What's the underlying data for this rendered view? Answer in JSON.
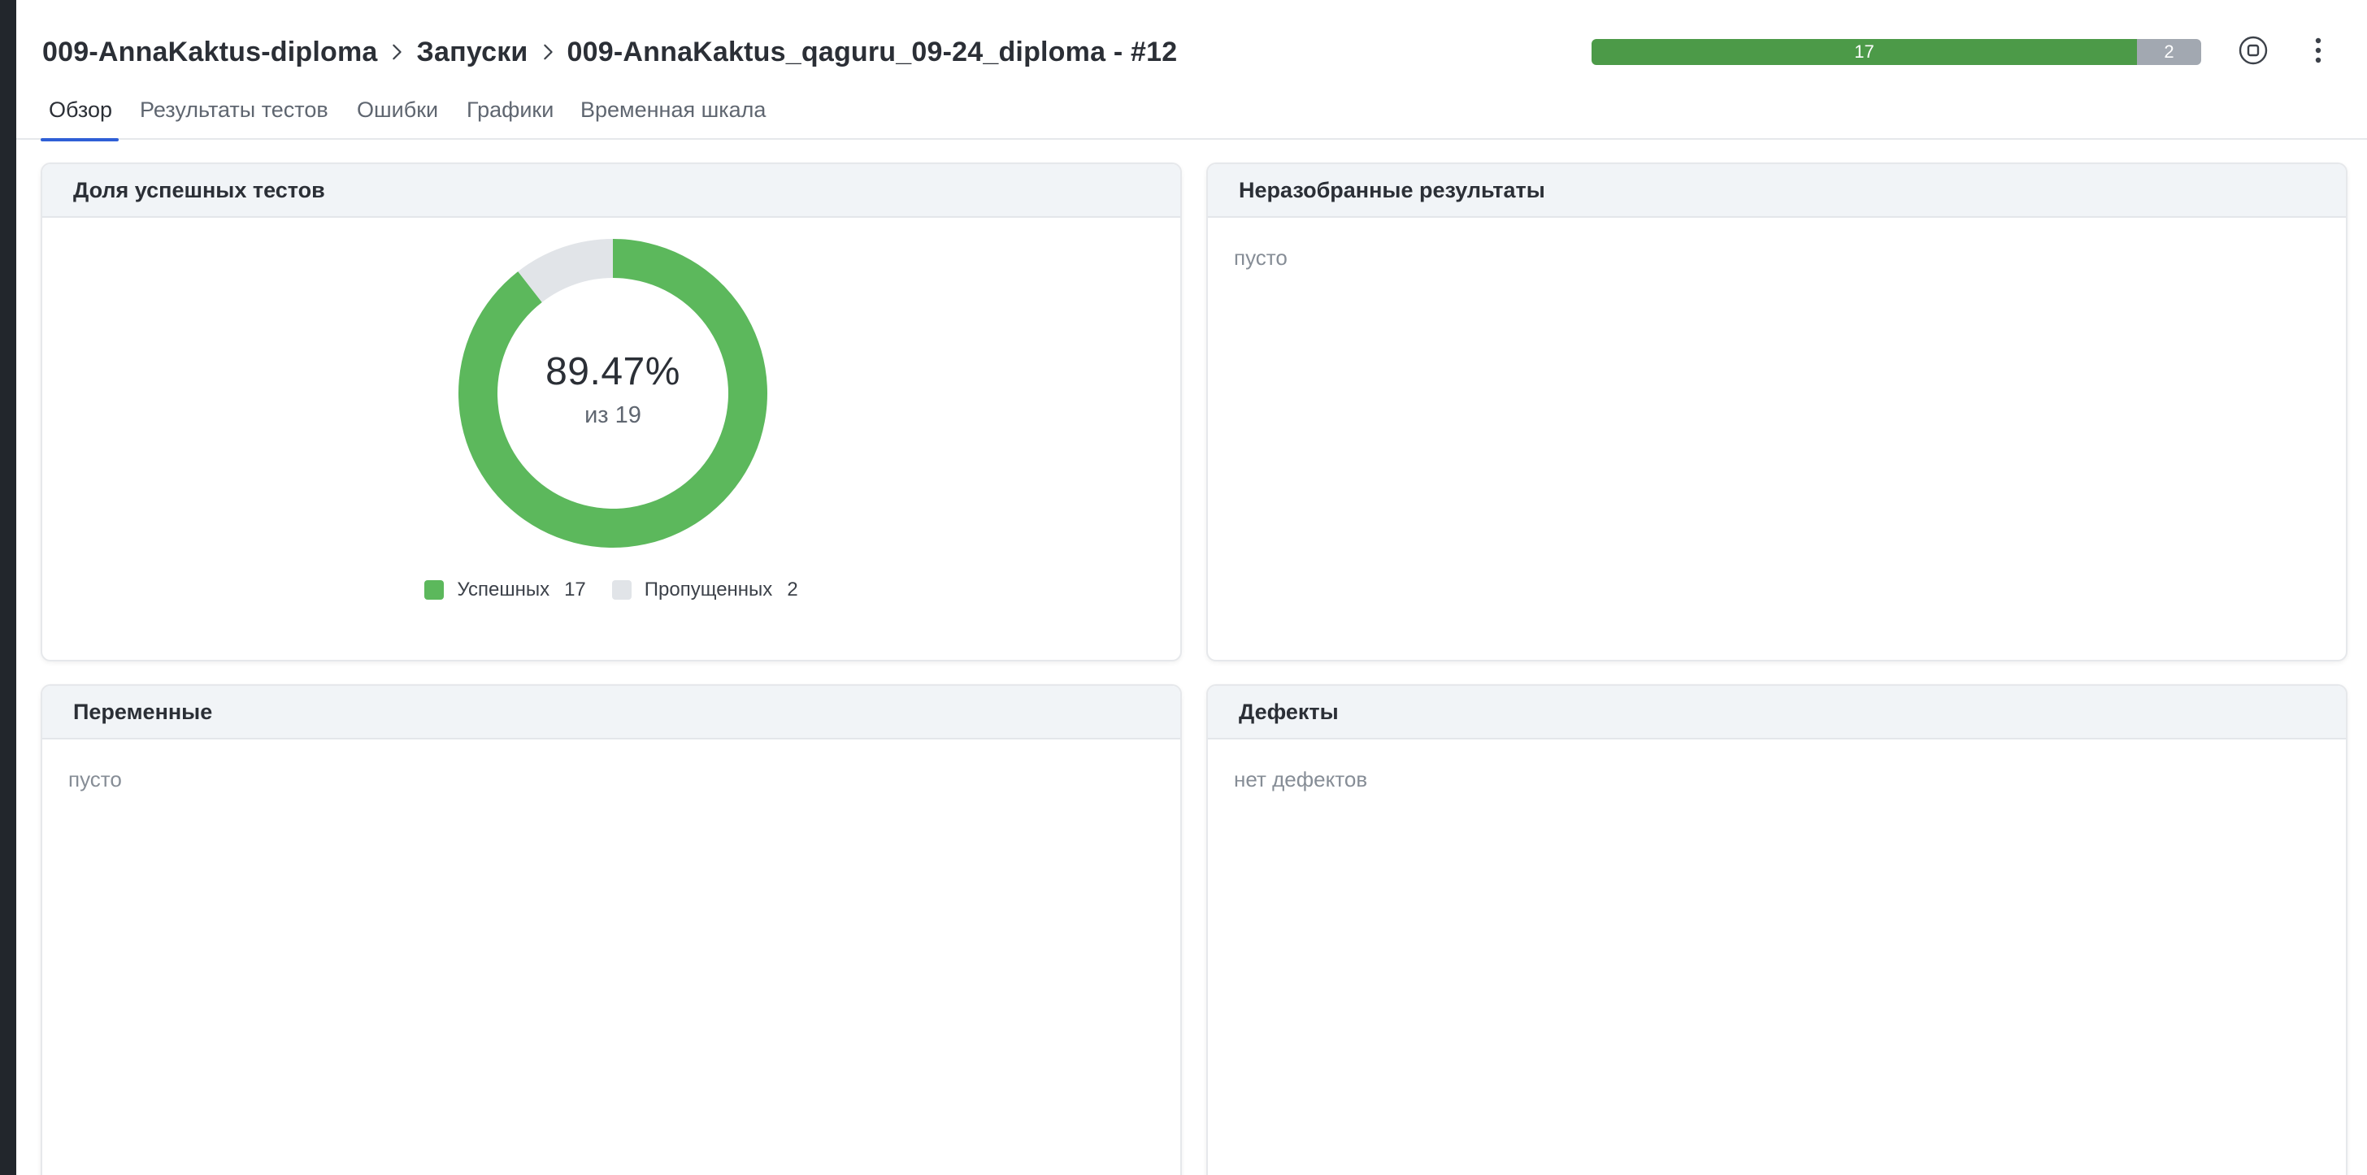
{
  "breadcrumb": {
    "project": "009-AnnaKaktus-diploma",
    "section": "Запуски",
    "launch": "009-AnnaKaktus_qaguru_09-24_diploma - #12"
  },
  "status_bar": {
    "passed": "17",
    "skipped": "2",
    "passed_fraction": 0.8947,
    "colors": {
      "passed": "#4c9a48",
      "skipped": "#a2a8b1"
    }
  },
  "tabs": [
    {
      "label": "Обзор",
      "active": true
    },
    {
      "label": "Результаты тестов",
      "active": false
    },
    {
      "label": "Ошибки",
      "active": false
    },
    {
      "label": "Графики",
      "active": false
    },
    {
      "label": "Временная шкала",
      "active": false
    }
  ],
  "cards": {
    "success_rate": {
      "title": "Доля успешных тестов",
      "percent": "89.47%",
      "total": "из 19",
      "legend": [
        {
          "label": "Успешных",
          "count": "17",
          "color": "#5cb85c"
        },
        {
          "label": "Пропущенных",
          "count": "2",
          "color": "#e1e4e8"
        }
      ]
    },
    "unresolved": {
      "title": "Неразобранные результаты",
      "empty": "пусто"
    },
    "variables": {
      "title": "Переменные",
      "empty": "пусто"
    },
    "defects": {
      "title": "Дефекты",
      "empty": "нет дефектов"
    }
  },
  "chart_data": {
    "type": "pie",
    "categories": [
      "Успешных",
      "Пропущенных"
    ],
    "values": [
      17,
      2
    ],
    "colors": [
      "#5cb85c",
      "#e1e4e8"
    ]
  },
  "icons": {
    "breadcrumb_separator": "chevron-right-icon",
    "stop": "stop-circle-icon",
    "more": "more-vertical-icon"
  }
}
